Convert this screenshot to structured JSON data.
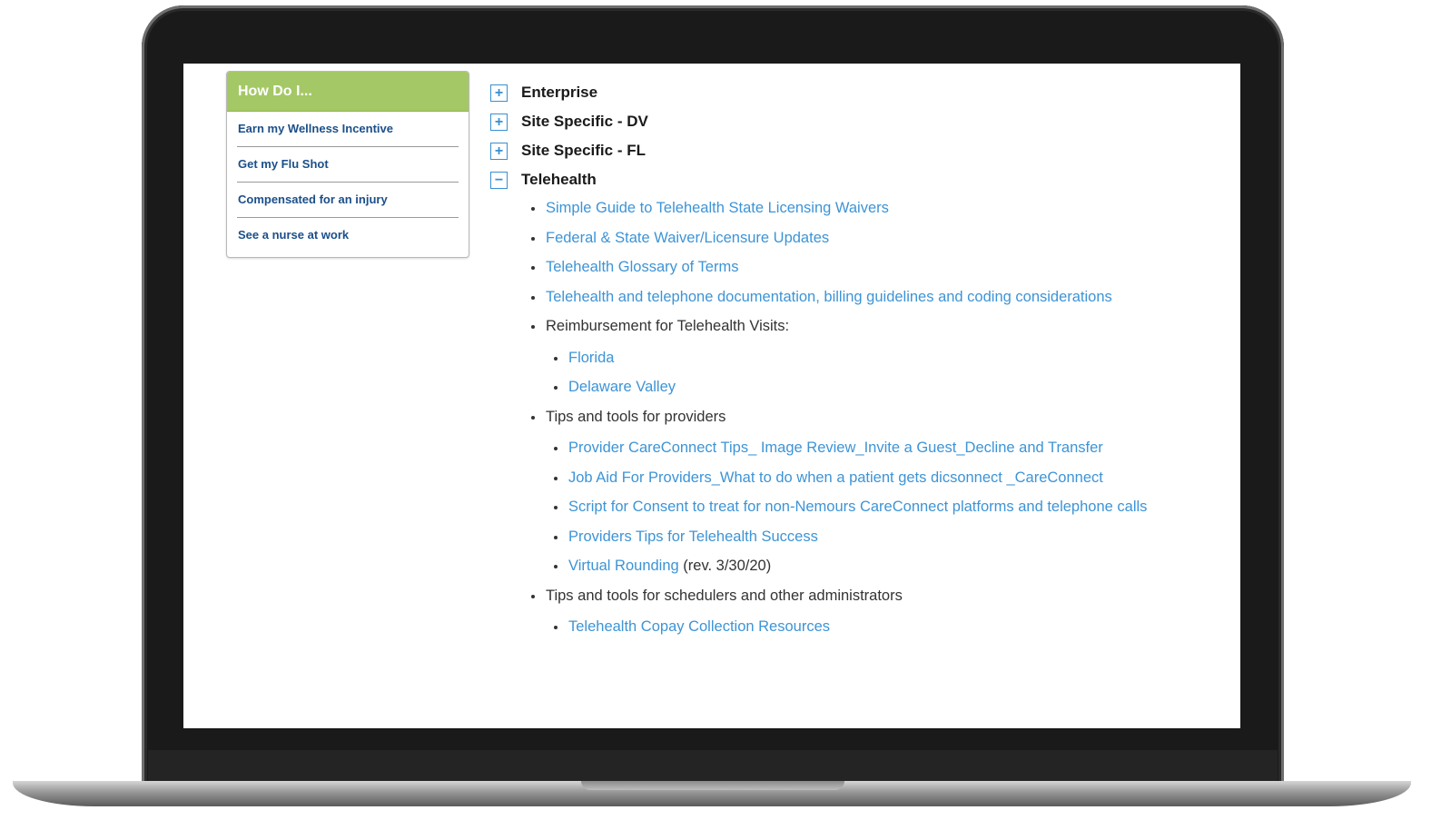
{
  "how_do_i": {
    "title": "How Do I...",
    "items": [
      {
        "label": "Earn my Wellness Incentive"
      },
      {
        "label": "Get my Flu Shot"
      },
      {
        "label": "Compensated for an injury"
      },
      {
        "label": "See a nurse at work"
      }
    ]
  },
  "accordion": {
    "sections": [
      {
        "toggle": "+",
        "title": "Enterprise"
      },
      {
        "toggle": "+",
        "title": "Site Specific - DV"
      },
      {
        "toggle": "+",
        "title": "Site Specific - FL"
      },
      {
        "toggle": "−",
        "title": "Telehealth"
      }
    ],
    "telehealth": {
      "links": [
        "Simple Guide to Telehealth State Licensing Waivers",
        "Federal & State Waiver/Licensure Updates",
        "Telehealth Glossary of Terms",
        "Telehealth and telephone documentation, billing guidelines and coding considerations"
      ],
      "reimbursement": {
        "label": "Reimbursement for Telehealth Visits:",
        "links": [
          "Florida",
          "Delaware Valley"
        ]
      },
      "providers": {
        "label": "Tips and tools for providers",
        "links": [
          "Provider CareConnect Tips_ Image Review_Invite a Guest_Decline and Transfer",
          "Job Aid For Providers_What to do when a patient gets dicsonnect _CareConnect",
          "Script for Consent to treat for non-Nemours CareConnect platforms and telephone calls",
          "Providers Tips for Telehealth Success"
        ],
        "virtual_rounding": {
          "link": "Virtual Rounding",
          "note": " (rev. 3/30/20)"
        }
      },
      "schedulers": {
        "label": "Tips and tools for schedulers and other administrators",
        "links": [
          "Telehealth Copay Collection Resources"
        ]
      }
    }
  },
  "colors": {
    "header_green": "#a4c866",
    "link_blue": "#3d94d6",
    "nav_blue": "#1b4f8a"
  }
}
